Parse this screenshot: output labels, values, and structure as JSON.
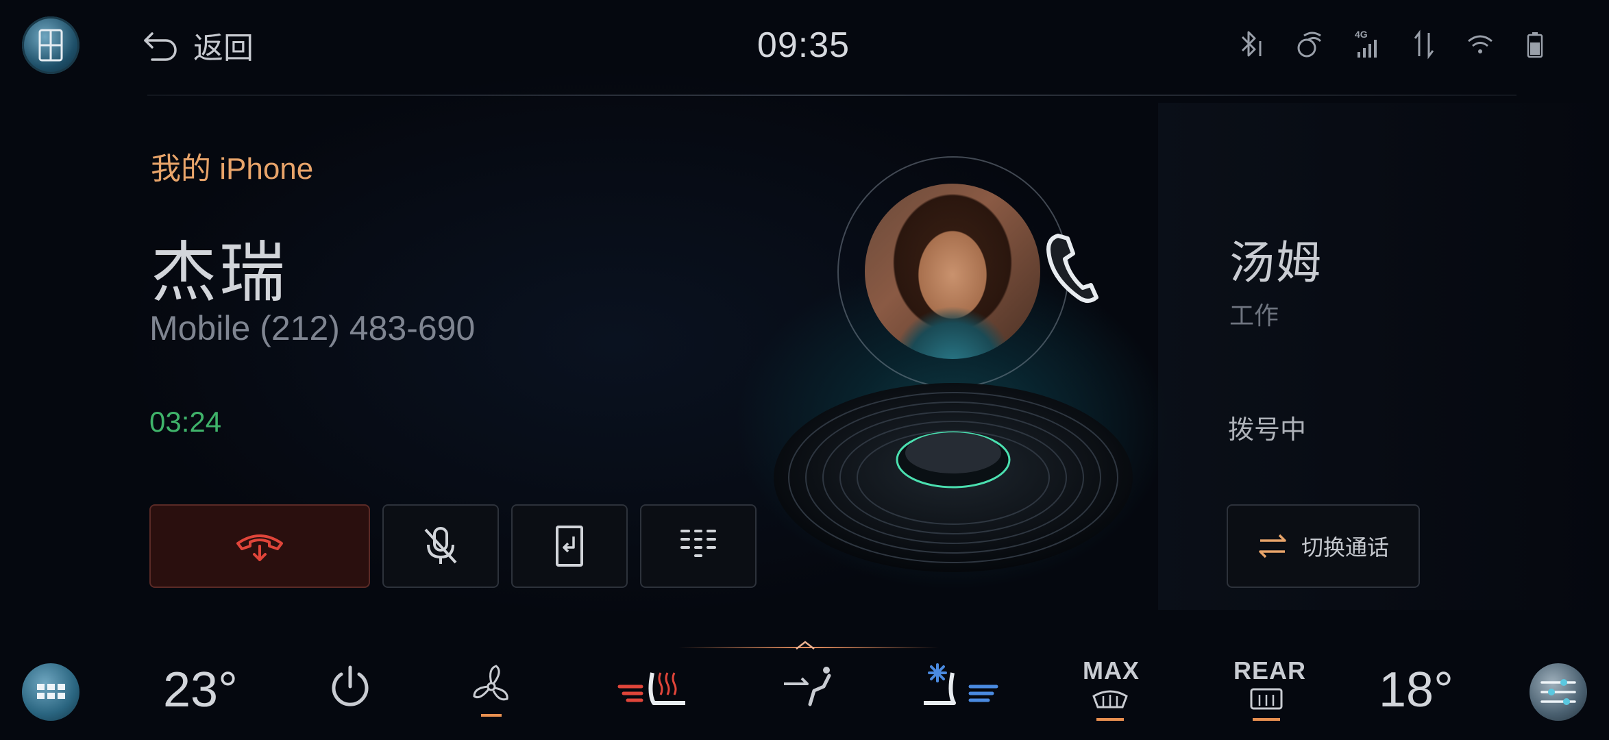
{
  "status_bar": {
    "back_label": "返回",
    "time": "09:35",
    "icons": [
      "bluetooth-icon",
      "voice-assistant-icon",
      "4g-signal-icon",
      "data-transfer-icon",
      "wifi-icon",
      "battery-icon"
    ],
    "network_label": "4G"
  },
  "call": {
    "device": "我的 iPhone",
    "caller_name": "杰瑞",
    "caller_number": "Mobile (212) 483-690",
    "duration": "03:24",
    "buttons": [
      "hang-up",
      "mute",
      "transfer-to-phone",
      "keypad"
    ]
  },
  "second_call": {
    "name": "汤姆",
    "type": "工作",
    "status": "拨号中",
    "switch_label": "切换通话"
  },
  "climate": {
    "driver_temp": "23°",
    "passenger_temp": "18°",
    "max_label": "MAX",
    "rear_label": "REAR"
  },
  "colors": {
    "accent_orange": "#e8a46a",
    "timer_green": "#3fb36a",
    "hangup_red": "#e0453a",
    "seat_cool_blue": "#4a8ae0"
  }
}
